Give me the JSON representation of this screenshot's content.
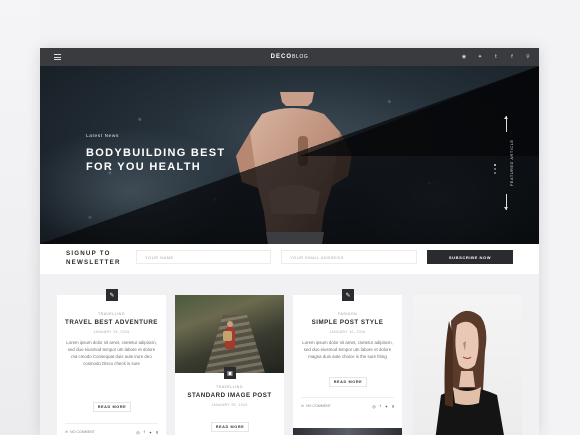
{
  "header": {
    "logo_bold": "DECO",
    "logo_thin": "BLOG",
    "menu_icon": "hamburger-icon",
    "social": [
      {
        "icon": "rss-icon",
        "glyph": "◉"
      },
      {
        "icon": "twitter-icon",
        "glyph": "✦"
      },
      {
        "icon": "tumblr-icon",
        "glyph": "t"
      },
      {
        "icon": "facebook-icon",
        "glyph": "f"
      },
      {
        "icon": "search-icon",
        "glyph": "⚲"
      }
    ]
  },
  "hero": {
    "kicker": "Latest News",
    "title": "BODYBUILDING BEST FOR YOU HEALTH",
    "side_label": "FEATURED ARTICLE"
  },
  "newsletter": {
    "title": "SIGNUP TO NEWSLETTER",
    "name_placeholder": "YOUR NAME",
    "email_placeholder": "YOUR EMAIL ADDRESS",
    "button": "SUBSCRIBE NOW"
  },
  "cards": [
    {
      "category": "TRAVELLING",
      "title": "TRAVEL BEST ADVENTURE",
      "date": "JANUARY 25, 2016",
      "excerpt": "Lorem ipsum dolor sit amet, csetetur adipiscin, sed duo eiusmod tempor utn labore et dolore ma cmodo Consequat duis aute irure deo cosmodo Disco check is sure",
      "read_more": "READ MORE",
      "comments": "NO COMMENT"
    },
    {
      "category": "TRAVELLING",
      "title": "STANDARD IMAGE POST",
      "date": "JANUARY 25, 2016",
      "read_more": "READ MORE"
    },
    {
      "category": "FASHION",
      "title": "SIMPLE POST STYLE",
      "date": "JANUARY 10, 2016",
      "excerpt": "Lorem ipsum dolor sit amet, csetetur adipiscin, sed duo eiusmod tempor utn labore et dolore magna duis aute choice is the sure thing",
      "read_more": "READ MORE",
      "comments": "NO COMMENT"
    }
  ]
}
